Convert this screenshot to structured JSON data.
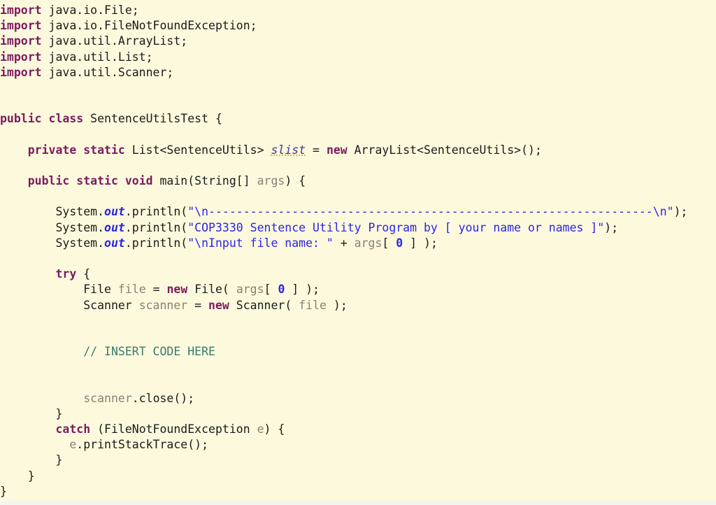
{
  "editor": {
    "language": "Java",
    "class_name": "SentenceUtilsTest",
    "background_color": "#fdf9dd",
    "colors": {
      "keyword": "#7b1b5e",
      "string": "#2a24e8",
      "comment": "#3a7a6a",
      "local_variable": "#8b7e74",
      "plain_text": "#1a1a1a",
      "static_field_underline": "#e8a317"
    }
  },
  "code": {
    "lines": [
      {
        "id": 1,
        "tokens": [
          {
            "t": "import",
            "c": "keyword"
          },
          {
            "t": " java.io.File;",
            "c": "plain"
          }
        ]
      },
      {
        "id": 2,
        "tokens": [
          {
            "t": "import",
            "c": "keyword"
          },
          {
            "t": " java.io.FileNotFoundException;",
            "c": "plain"
          }
        ]
      },
      {
        "id": 3,
        "tokens": [
          {
            "t": "import",
            "c": "keyword"
          },
          {
            "t": " java.util.ArrayList;",
            "c": "plain"
          }
        ]
      },
      {
        "id": 4,
        "tokens": [
          {
            "t": "import",
            "c": "keyword"
          },
          {
            "t": " java.util.List;",
            "c": "plain"
          }
        ]
      },
      {
        "id": 5,
        "tokens": [
          {
            "t": "import",
            "c": "keyword"
          },
          {
            "t": " java.util.Scanner;",
            "c": "plain"
          }
        ]
      },
      {
        "id": 6,
        "tokens": []
      },
      {
        "id": 7,
        "tokens": []
      },
      {
        "id": 8,
        "tokens": [
          {
            "t": "public class",
            "c": "keyword"
          },
          {
            "t": " SentenceUtilsTest {",
            "c": "plain"
          }
        ]
      },
      {
        "id": 9,
        "tokens": []
      },
      {
        "id": 10,
        "tokens": [
          {
            "t": "    ",
            "c": "plain"
          },
          {
            "t": "private static",
            "c": "keyword"
          },
          {
            "t": " List<SentenceUtils> ",
            "c": "plain"
          },
          {
            "t": "slist",
            "c": "static-field"
          },
          {
            "t": " = ",
            "c": "plain"
          },
          {
            "t": "new",
            "c": "keyword"
          },
          {
            "t": " ArrayList<SentenceUtils>();",
            "c": "plain"
          }
        ]
      },
      {
        "id": 11,
        "tokens": []
      },
      {
        "id": 12,
        "tokens": [
          {
            "t": "    ",
            "c": "plain"
          },
          {
            "t": "public static void",
            "c": "keyword"
          },
          {
            "t": " main(String[] ",
            "c": "plain"
          },
          {
            "t": "args",
            "c": "local"
          },
          {
            "t": ") {",
            "c": "plain"
          }
        ]
      },
      {
        "id": 13,
        "tokens": []
      },
      {
        "id": 14,
        "tokens": [
          {
            "t": "        System.",
            "c": "plain"
          },
          {
            "t": "out",
            "c": "field"
          },
          {
            "t": ".println(",
            "c": "plain"
          },
          {
            "t": "\"\\n----------------------------------------------------------------\\n\"",
            "c": "string"
          },
          {
            "t": ");",
            "c": "plain"
          }
        ]
      },
      {
        "id": 15,
        "tokens": [
          {
            "t": "        System.",
            "c": "plain"
          },
          {
            "t": "out",
            "c": "field"
          },
          {
            "t": ".println(",
            "c": "plain"
          },
          {
            "t": "\"COP3330 Sentence Utility Program by [ your name or names ]\"",
            "c": "string"
          },
          {
            "t": ");",
            "c": "plain"
          }
        ]
      },
      {
        "id": 16,
        "tokens": [
          {
            "t": "        System.",
            "c": "plain"
          },
          {
            "t": "out",
            "c": "field"
          },
          {
            "t": ".println(",
            "c": "plain"
          },
          {
            "t": "\"\\nInput file name: \"",
            "c": "string"
          },
          {
            "t": " + ",
            "c": "plain"
          },
          {
            "t": "args",
            "c": "local"
          },
          {
            "t": "[ ",
            "c": "plain"
          },
          {
            "t": "0",
            "c": "number"
          },
          {
            "t": " ] );",
            "c": "plain"
          }
        ]
      },
      {
        "id": 17,
        "tokens": []
      },
      {
        "id": 18,
        "tokens": [
          {
            "t": "        ",
            "c": "plain"
          },
          {
            "t": "try",
            "c": "keyword"
          },
          {
            "t": " {",
            "c": "plain"
          }
        ]
      },
      {
        "id": 19,
        "tokens": [
          {
            "t": "            File ",
            "c": "plain"
          },
          {
            "t": "file",
            "c": "local"
          },
          {
            "t": " = ",
            "c": "plain"
          },
          {
            "t": "new",
            "c": "keyword"
          },
          {
            "t": " File( ",
            "c": "plain"
          },
          {
            "t": "args",
            "c": "local"
          },
          {
            "t": "[ ",
            "c": "plain"
          },
          {
            "t": "0",
            "c": "number"
          },
          {
            "t": " ] );",
            "c": "plain"
          }
        ]
      },
      {
        "id": 20,
        "tokens": [
          {
            "t": "            Scanner ",
            "c": "plain"
          },
          {
            "t": "scanner",
            "c": "local"
          },
          {
            "t": " = ",
            "c": "plain"
          },
          {
            "t": "new",
            "c": "keyword"
          },
          {
            "t": " Scanner( ",
            "c": "plain"
          },
          {
            "t": "file",
            "c": "local"
          },
          {
            "t": " );",
            "c": "plain"
          }
        ]
      },
      {
        "id": 21,
        "tokens": []
      },
      {
        "id": 22,
        "tokens": []
      },
      {
        "id": 23,
        "tokens": [
          {
            "t": "            ",
            "c": "plain"
          },
          {
            "t": "// INSERT CODE HERE",
            "c": "comment"
          }
        ]
      },
      {
        "id": 24,
        "tokens": []
      },
      {
        "id": 25,
        "tokens": []
      },
      {
        "id": 26,
        "tokens": [
          {
            "t": "            ",
            "c": "plain"
          },
          {
            "t": "scanner",
            "c": "local"
          },
          {
            "t": ".close();",
            "c": "plain"
          }
        ]
      },
      {
        "id": 27,
        "tokens": [
          {
            "t": "        }",
            "c": "plain"
          }
        ]
      },
      {
        "id": 28,
        "tokens": [
          {
            "t": "        ",
            "c": "plain"
          },
          {
            "t": "catch",
            "c": "keyword"
          },
          {
            "t": " (FileNotFoundException ",
            "c": "plain"
          },
          {
            "t": "e",
            "c": "local"
          },
          {
            "t": ") {",
            "c": "plain"
          }
        ]
      },
      {
        "id": 29,
        "tokens": [
          {
            "t": "          ",
            "c": "plain"
          },
          {
            "t": "e",
            "c": "local"
          },
          {
            "t": ".printStackTrace();",
            "c": "plain"
          }
        ]
      },
      {
        "id": 30,
        "tokens": [
          {
            "t": "        }",
            "c": "plain"
          }
        ]
      },
      {
        "id": 31,
        "tokens": [
          {
            "t": "    }",
            "c": "plain"
          }
        ]
      },
      {
        "id": 32,
        "tokens": [
          {
            "t": "}",
            "c": "plain"
          }
        ]
      }
    ]
  }
}
